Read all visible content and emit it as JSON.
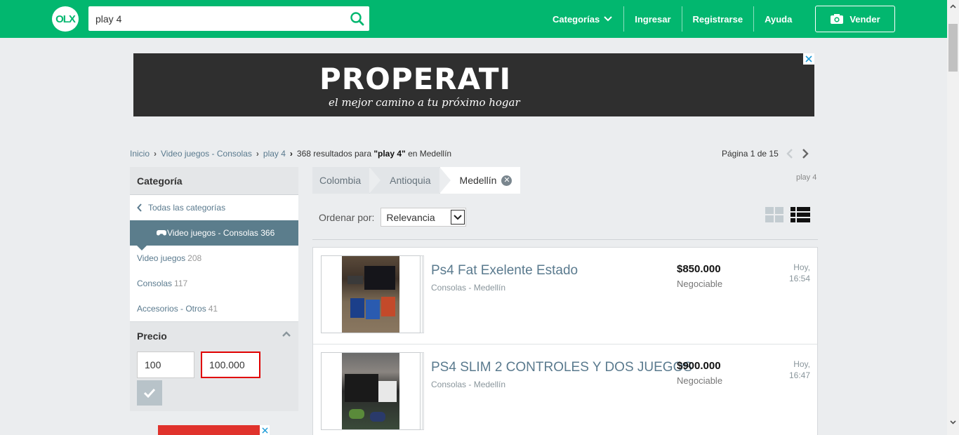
{
  "header": {
    "logo_text": "OLX",
    "search_value": "play 4",
    "nav": {
      "categorias": "Categorías",
      "ingresar": "Ingresar",
      "registrarse": "Registrarse",
      "ayuda": "Ayuda"
    },
    "vender": "Vender"
  },
  "banner": {
    "brand": "PROPERATI",
    "tagline": "el mejor camino a tu próximo hogar",
    "brand_color": "#2f2f2f"
  },
  "breadcrumb": {
    "items": [
      "Inicio",
      "Video juegos - Consolas",
      "play 4"
    ],
    "result_prefix": "368 resultados para ",
    "result_query": "\"play 4\"",
    "result_suffix": " en Medellín"
  },
  "pager": {
    "label": "Página 1 de 15"
  },
  "sidebar": {
    "category_title": "Categoría",
    "all_categories": "Todas las categorías",
    "active": {
      "label": "Video juegos - Consolas",
      "count": "366"
    },
    "items": [
      {
        "label": "Video juegos",
        "count": "208"
      },
      {
        "label": "Consolas",
        "count": "117"
      },
      {
        "label": "Accesorios - Otros",
        "count": "41"
      }
    ],
    "price_title": "Precio",
    "price_min": "100",
    "price_max": "100.000"
  },
  "location": {
    "chips": [
      "Colombia",
      "Antioquia",
      "Medellín"
    ],
    "query_tag": "play 4"
  },
  "sort": {
    "label": "Ordenar por:",
    "value": "Relevancia"
  },
  "listings": [
    {
      "title": "Ps4 Fat Exelente Estado",
      "subtitle": "Consolas - Medellín",
      "price": "$850.000",
      "negotiable": "Negociable",
      "date_day": "Hoy,",
      "date_time": "16:54"
    },
    {
      "title": "PS4 SLIM 2 CONTROLES Y DOS JUEGOS",
      "subtitle": "Consolas - Medellín",
      "price": "$900.000",
      "negotiable": "Negociable",
      "date_day": "Hoy,",
      "date_time": "16:47"
    }
  ],
  "colors": {
    "brand_green": "#02b76f",
    "sidebar_active": "#5b7d8c",
    "link": "#5a7a8e"
  }
}
